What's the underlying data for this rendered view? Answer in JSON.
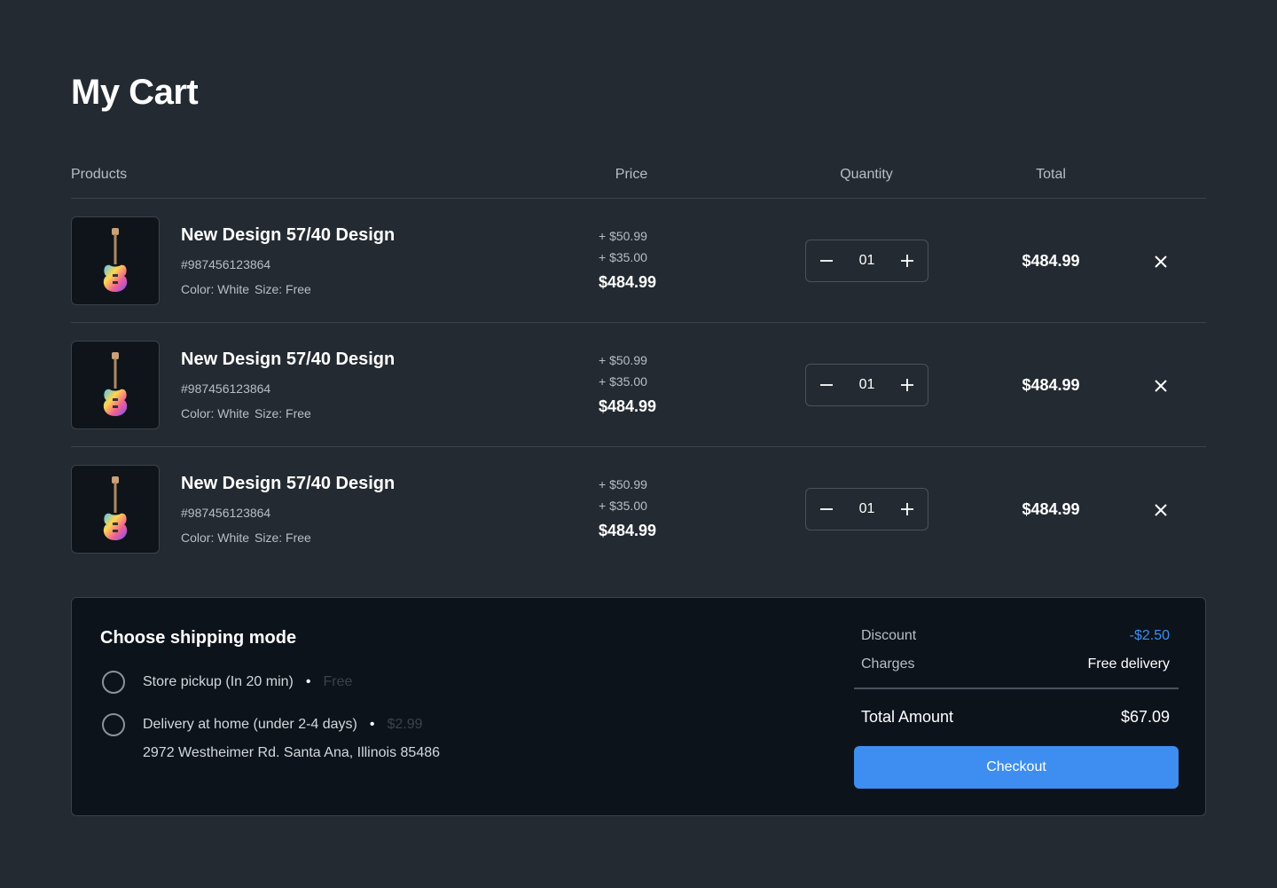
{
  "page": {
    "title": "My Cart"
  },
  "table": {
    "headers": {
      "products": "Products",
      "price": "Price",
      "quantity": "Quantity",
      "total": "Total"
    }
  },
  "cart_items": [
    {
      "name": "New Design 57/40 Design",
      "sku": "#987456123864",
      "color": "Color: White",
      "size": "Size: Free",
      "price_add_1": "+ $50.99",
      "price_add_2": "+ $35.00",
      "price": "$484.99",
      "quantity": "01",
      "total": "$484.99"
    },
    {
      "name": "New Design 57/40 Design",
      "sku": "#987456123864",
      "color": "Color: White",
      "size": "Size: Free",
      "price_add_1": "+ $50.99",
      "price_add_2": "+ $35.00",
      "price": "$484.99",
      "quantity": "01",
      "total": "$484.99"
    },
    {
      "name": "New Design 57/40 Design",
      "sku": "#987456123864",
      "color": "Color: White",
      "size": "Size: Free",
      "price_add_1": "+ $50.99",
      "price_add_2": "+ $35.00",
      "price": "$484.99",
      "quantity": "01",
      "total": "$484.99"
    }
  ],
  "shipping": {
    "title": "Choose shipping mode",
    "options": [
      {
        "label": "Store pickup (In 20 min)",
        "fee": "Free"
      },
      {
        "label": "Delivery at home (under 2-4 days)",
        "fee": "$2.99"
      }
    ],
    "address": "2972 Westheimer Rd. Santa Ana, Illinois 85486"
  },
  "summary": {
    "discount_label": "Discount",
    "discount_value": "-$2.50",
    "charges_label": "Charges",
    "charges_value": "Free delivery",
    "total_label": "Total Amount",
    "total_value": "$67.09",
    "checkout_label": "Checkout"
  },
  "colors": {
    "background": "#232a31",
    "panel": "#0d131b",
    "accent": "#3d8ef0",
    "border": "#3a424b"
  },
  "icons": {
    "product_image": "guitar-icon",
    "decrease": "minus-icon",
    "increase": "plus-icon",
    "remove": "close-icon"
  }
}
